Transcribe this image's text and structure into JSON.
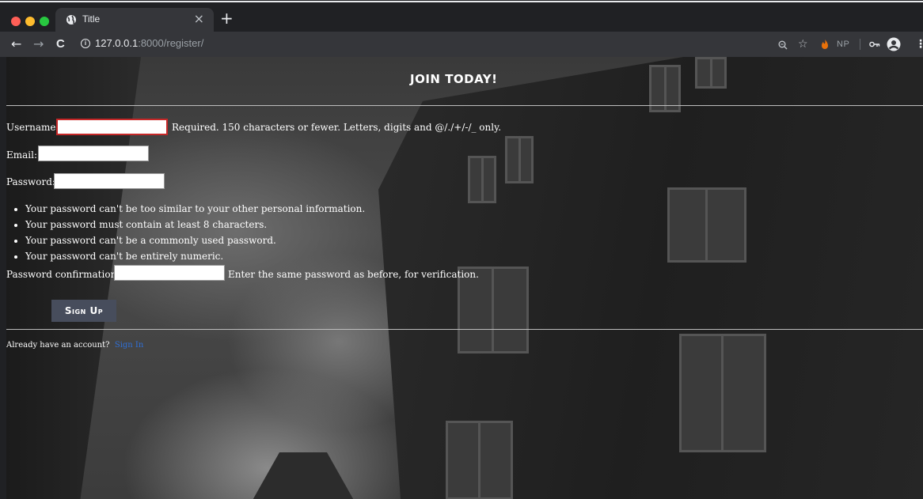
{
  "browser": {
    "tab_title": "Title",
    "tab_close": "×",
    "new_tab": "+",
    "nav_back": "←",
    "nav_forward": "→",
    "nav_reload": "C",
    "url_host": "127.0.0.1",
    "url_path": ":8000/register/",
    "extension_np": "NP",
    "traffic_colors": [
      "#ff5f57",
      "#febc2e",
      "#28c840"
    ]
  },
  "page": {
    "heading": "JOIN TODAY!",
    "form": {
      "username_label": "Username:",
      "username_value": "",
      "username_help": "Required. 150 characters or fewer. Letters, digits and @/./+/-/_ only.",
      "email_label": "Email:",
      "email_value": "",
      "password_label": "Password:",
      "password_value": "",
      "password_rules": [
        "Your password can't be too similar to your other personal information.",
        "Your password must contain at least 8 characters.",
        "Your password can't be a commonly used password.",
        "Your password can't be entirely numeric."
      ],
      "confirm_label": "Password confirmation:",
      "confirm_value": "",
      "confirm_help": "Enter the same password as before, for verification.",
      "submit_label": "Sign Up"
    },
    "footer": {
      "prompt": "Already have an account?",
      "link": "Sign In"
    }
  }
}
